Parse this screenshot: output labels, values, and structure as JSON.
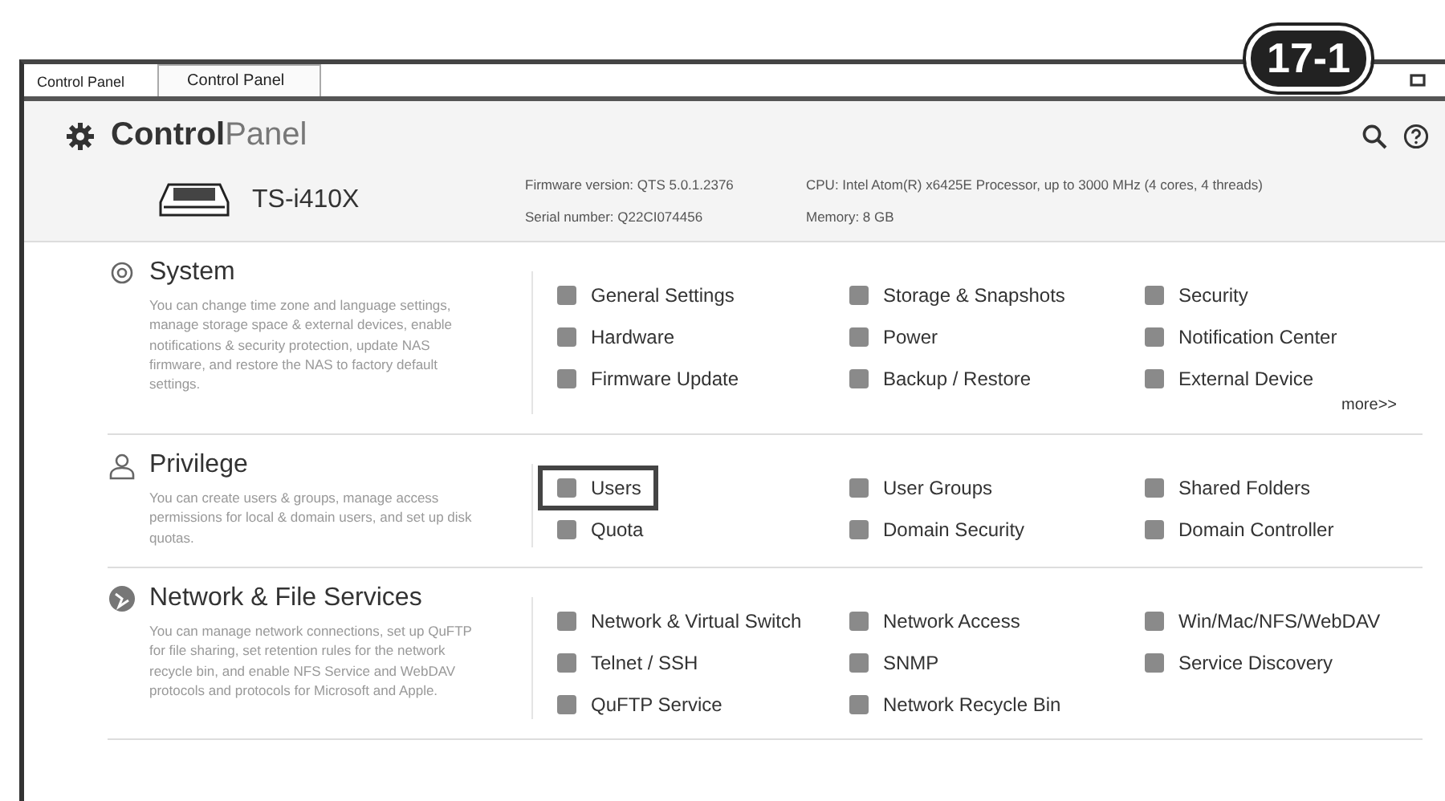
{
  "window": {
    "tabs": [
      {
        "label": "Control Panel",
        "selected": false
      },
      {
        "label": "Control Panel",
        "selected": true
      }
    ]
  },
  "callout": "17-1",
  "header": {
    "title_bold": "Control",
    "title_light": "Panel"
  },
  "device": {
    "model": "TS-i410X",
    "info": [
      {
        "label": "Firmware version:",
        "value": "QTS 5.0.1.2376"
      },
      {
        "label": "CPU:",
        "value": "Intel Atom(R) x6425E Processor, up to 3000 MHz (4 cores, 4 threads)"
      },
      {
        "label": "Serial number:",
        "value": "Q22CI074456"
      },
      {
        "label": "Memory:",
        "value": "8 GB"
      }
    ]
  },
  "sections": [
    {
      "kind": "system",
      "title": "System",
      "description": "You can change time zone and language settings, manage storage space & external devices, enable notifications & security protection, update NAS firmware, and restore the NAS to factory default settings.",
      "more": "more>>",
      "items": [
        {
          "label": "General Settings",
          "highlighted": false
        },
        {
          "label": "Storage & Snapshots",
          "highlighted": false
        },
        {
          "label": "Security",
          "highlighted": false
        },
        {
          "label": "Hardware",
          "highlighted": false
        },
        {
          "label": "Power",
          "highlighted": false
        },
        {
          "label": "Notification Center",
          "highlighted": false
        },
        {
          "label": "Firmware Update",
          "highlighted": false
        },
        {
          "label": "Backup / Restore",
          "highlighted": false
        },
        {
          "label": "External Device",
          "highlighted": false
        }
      ]
    },
    {
      "kind": "privilege",
      "title": "Privilege",
      "description": "You can create users & groups, manage access permissions for local & domain users, and set up disk quotas.",
      "items": [
        {
          "label": "Users",
          "highlighted": true
        },
        {
          "label": "User Groups",
          "highlighted": false
        },
        {
          "label": "Shared Folders",
          "highlighted": false
        },
        {
          "label": "Quota",
          "highlighted": false
        },
        {
          "label": "Domain Security",
          "highlighted": false
        },
        {
          "label": "Domain Controller",
          "highlighted": false
        }
      ]
    },
    {
      "kind": "network",
      "title": "Network & File Services",
      "description": "You can manage network connections, set up QuFTP for file sharing, set retention rules for the network recycle bin, and enable NFS Service and WebDAV protocols and protocols for Microsoft and Apple.",
      "items": [
        {
          "label": "Network & Virtual Switch",
          "highlighted": false
        },
        {
          "label": "Network Access",
          "highlighted": false
        },
        {
          "label": "Win/Mac/NFS/WebDAV",
          "highlighted": false
        },
        {
          "label": "Telnet / SSH",
          "highlighted": false
        },
        {
          "label": "SNMP",
          "highlighted": false
        },
        {
          "label": "Service Discovery",
          "highlighted": false
        },
        {
          "label": "QuFTP Service",
          "highlighted": false
        },
        {
          "label": "Network Recycle Bin",
          "highlighted": false
        }
      ]
    }
  ]
}
